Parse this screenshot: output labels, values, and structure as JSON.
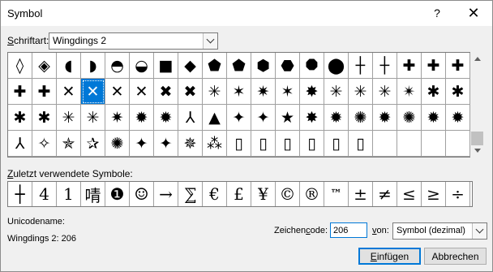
{
  "window": {
    "title": "Symbol",
    "help": "?",
    "close": "✕"
  },
  "font": {
    "label_prefix": "",
    "label_underlined": "S",
    "label_rest": "chriftart:",
    "value": "Wingdings 2"
  },
  "grid": {
    "rows": [
      [
        "◊",
        "◈",
        "◖",
        "◗",
        "◓",
        "◒",
        "■",
        "◆",
        "⬟",
        "⬟",
        "⬢",
        "⬣",
        "⯃",
        "⬤",
        "┼",
        "┼",
        "✚",
        "✚",
        "✚"
      ],
      [
        "✚",
        "✚",
        "✕",
        "✕",
        "✕",
        "✕",
        "✖",
        "✖",
        "✳",
        "✶",
        "✷",
        "✶",
        "✸",
        "✳",
        "✳",
        "✳",
        "✴",
        "✱",
        "✱"
      ],
      [
        "✱",
        "✱",
        "✳",
        "✳",
        "✷",
        "✹",
        "✹",
        "⅄",
        "▲",
        "✦",
        "✦",
        "★",
        "✸",
        "✹",
        "✺",
        "✹",
        "✺",
        "✹",
        "✹"
      ],
      [
        "⅄",
        "✧",
        "✯",
        "✰",
        "✺",
        "✦",
        "✦",
        "✵",
        "⁂",
        "▯",
        "▯",
        "▯",
        "▯",
        "▯",
        "▯",
        "",
        "",
        "",
        ""
      ]
    ],
    "selected_row": 1,
    "selected_col": 3
  },
  "recent": {
    "label_underlined": "Z",
    "label_rest": "uletzt verwendete Symbole:",
    "symbols": [
      "┼",
      "4",
      "1",
      "啨",
      "❶",
      "☺",
      "→",
      "⅀",
      "€",
      "£",
      "¥",
      "©",
      "®",
      "™",
      "±",
      "≠",
      "≤",
      "≥",
      "÷"
    ]
  },
  "unicode": {
    "name_label": "Unicodename:",
    "name_value": "Wingdings 2: 206"
  },
  "code": {
    "label_before": "Zeichen",
    "label_underlined": "c",
    "label_after": "ode:",
    "value": "206"
  },
  "from": {
    "label_underlined": "v",
    "label_rest": "on:",
    "value": "Symbol (dezimal)"
  },
  "buttons": {
    "insert_underlined": "E",
    "insert_rest": "infügen",
    "cancel": "Abbrechen"
  }
}
